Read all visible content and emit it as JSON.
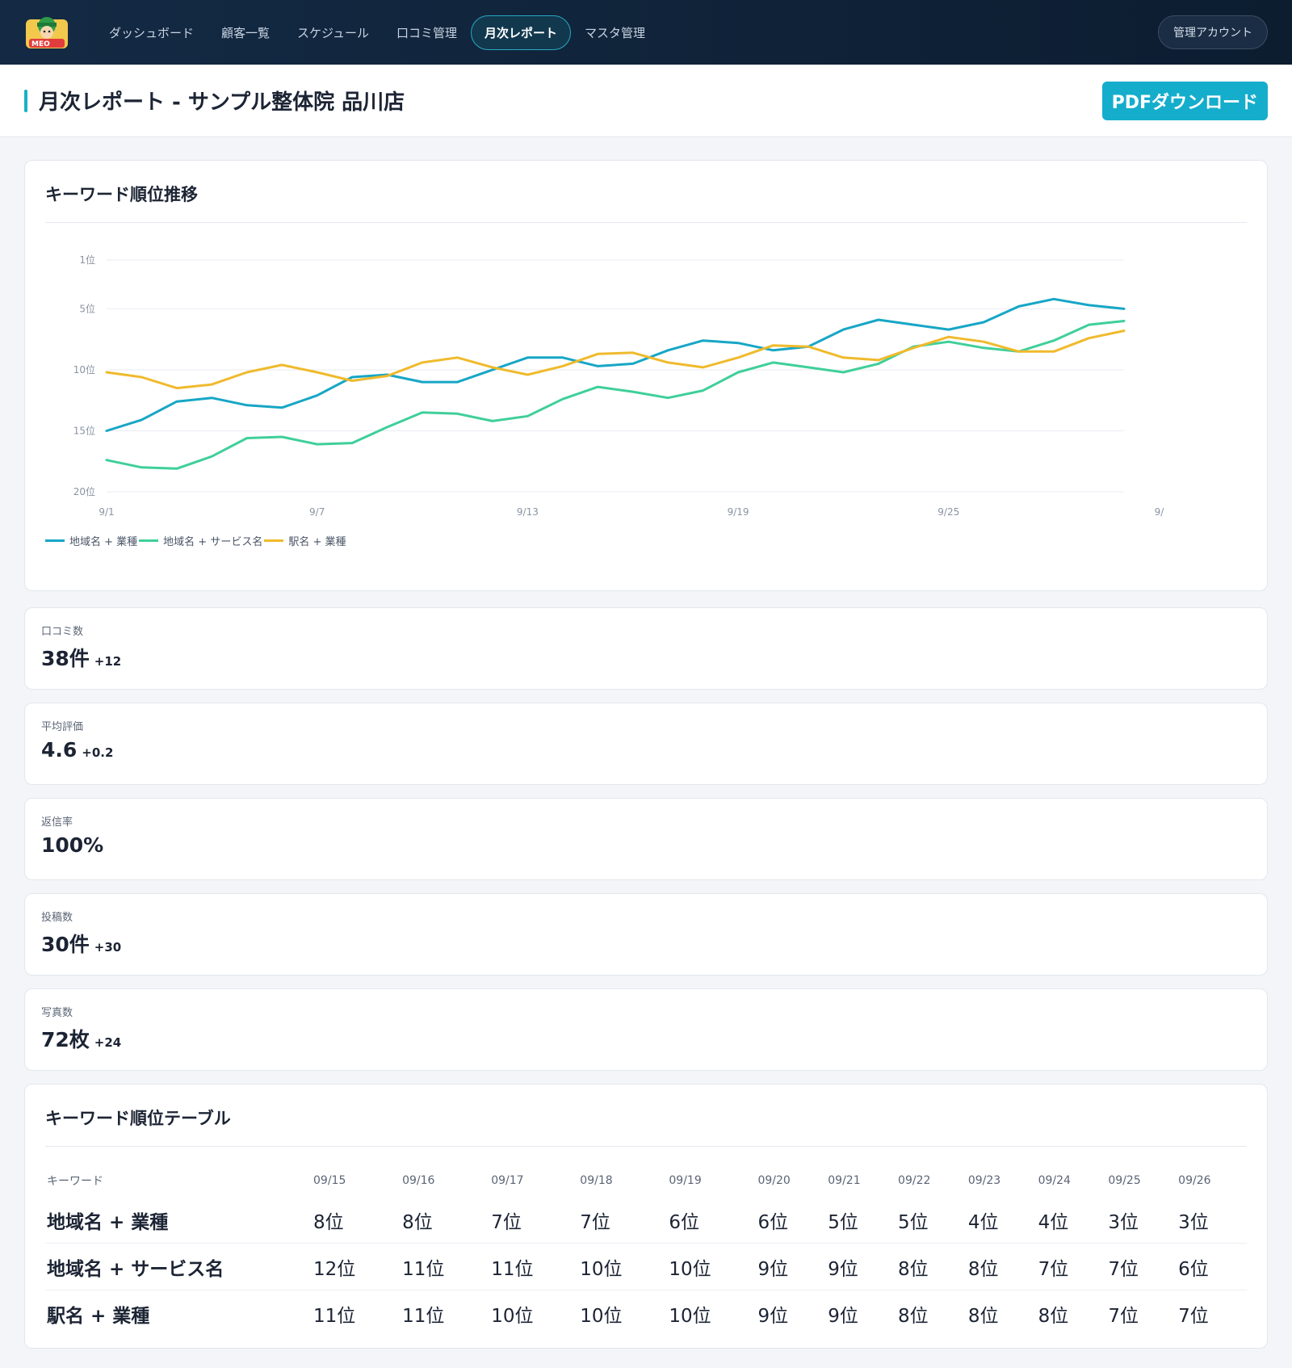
{
  "nav": {
    "items": [
      {
        "label": "ダッシュボード",
        "active": false
      },
      {
        "label": "顧客一覧",
        "active": false
      },
      {
        "label": "スケジュール",
        "active": false
      },
      {
        "label": "口コミ管理",
        "active": false
      },
      {
        "label": "月次レポート",
        "active": true
      },
      {
        "label": "マスタ管理",
        "active": false
      }
    ],
    "account_label": "管理アカウント",
    "logo_icon": "meo-mascot-logo",
    "logo_text": "MEO"
  },
  "header": {
    "title": "月次レポート - サンプル整体院 品川店",
    "pdf_label": "PDFダウンロード"
  },
  "chart_section": {
    "title": "キーワード順位推移"
  },
  "chart_data": {
    "type": "line",
    "title": "キーワード順位推移",
    "x": [
      "9/1",
      "9/2",
      "9/3",
      "9/4",
      "9/5",
      "9/6",
      "9/7",
      "9/8",
      "9/9",
      "9/10",
      "9/11",
      "9/12",
      "9/13",
      "9/14",
      "9/15",
      "9/16",
      "9/17",
      "9/18",
      "9/19",
      "9/20",
      "9/21",
      "9/22",
      "9/23",
      "9/24",
      "9/25",
      "9/26",
      "9/27",
      "9/28",
      "9/29",
      "9/30"
    ],
    "x_ticks": [
      "9/1",
      "9/7",
      "9/13",
      "9/19",
      "9/25",
      "9/"
    ],
    "y_ticks": [
      "1位",
      "5位",
      "10位",
      "15位",
      "20位"
    ],
    "y_tick_values": [
      1,
      5,
      10,
      15,
      20
    ],
    "ylim": [
      1,
      20
    ],
    "y_inverted": true,
    "grid": true,
    "legend_position": "bottom-left",
    "series": [
      {
        "name": "地域名 + 業種",
        "color": "#17a6c6",
        "values": [
          15.0,
          14.1,
          12.6,
          12.3,
          12.9,
          13.1,
          12.1,
          10.6,
          10.4,
          11.0,
          11.0,
          10.0,
          9.0,
          9.0,
          9.7,
          9.5,
          8.4,
          7.6,
          7.8,
          8.4,
          8.1,
          6.7,
          5.9,
          6.3,
          6.7,
          6.1,
          4.8,
          4.2,
          4.7,
          5.0
        ]
      },
      {
        "name": "地域名 + サービス名",
        "color": "#3fcf9a",
        "values": [
          17.4,
          18.0,
          18.1,
          17.1,
          15.6,
          15.5,
          16.1,
          16.0,
          14.7,
          13.5,
          13.6,
          14.2,
          13.8,
          12.4,
          11.4,
          11.8,
          12.3,
          11.7,
          10.2,
          9.4,
          9.8,
          10.2,
          9.5,
          8.1,
          7.7,
          8.2,
          8.5,
          7.6,
          6.3,
          6.0
        ]
      },
      {
        "name": "駅名 + 業種",
        "color": "#efba2c",
        "values": [
          10.2,
          10.6,
          11.5,
          11.2,
          10.2,
          9.6,
          10.2,
          10.9,
          10.5,
          9.4,
          9.0,
          9.8,
          10.4,
          9.7,
          8.7,
          8.6,
          9.4,
          9.8,
          9.0,
          8.0,
          8.1,
          9.0,
          9.2,
          8.2,
          7.3,
          7.7,
          8.5,
          8.5,
          7.4,
          6.8
        ]
      }
    ]
  },
  "stats": [
    {
      "label": "口コミ数",
      "value": "38件",
      "delta": "+12"
    },
    {
      "label": "平均評価",
      "value": "4.6",
      "delta": "+0.2"
    },
    {
      "label": "返信率",
      "value": "100%",
      "delta": ""
    },
    {
      "label": "投稿数",
      "value": "30件",
      "delta": "+30"
    },
    {
      "label": "写真数",
      "value": "72枚",
      "delta": "+24"
    }
  ],
  "table_section": {
    "title": "キーワード順位テーブル",
    "headers": [
      "キーワード",
      "09/15",
      "09/16",
      "09/17",
      "09/18",
      "09/19",
      "09/20",
      "09/21",
      "09/22",
      "09/23",
      "09/24",
      "09/25",
      "09/26"
    ],
    "rows": [
      [
        "地域名 + 業種",
        "8位",
        "8位",
        "7位",
        "7位",
        "6位",
        "6位",
        "5位",
        "5位",
        "4位",
        "4位",
        "3位",
        "3位"
      ],
      [
        "地域名 + サービス名",
        "12位",
        "11位",
        "11位",
        "10位",
        "10位",
        "9位",
        "9位",
        "8位",
        "8位",
        "7位",
        "7位",
        "6位"
      ],
      [
        "駅名 + 業種",
        "11位",
        "11位",
        "10位",
        "10位",
        "10位",
        "9位",
        "9位",
        "8位",
        "8位",
        "8位",
        "7位",
        "7位"
      ]
    ]
  }
}
